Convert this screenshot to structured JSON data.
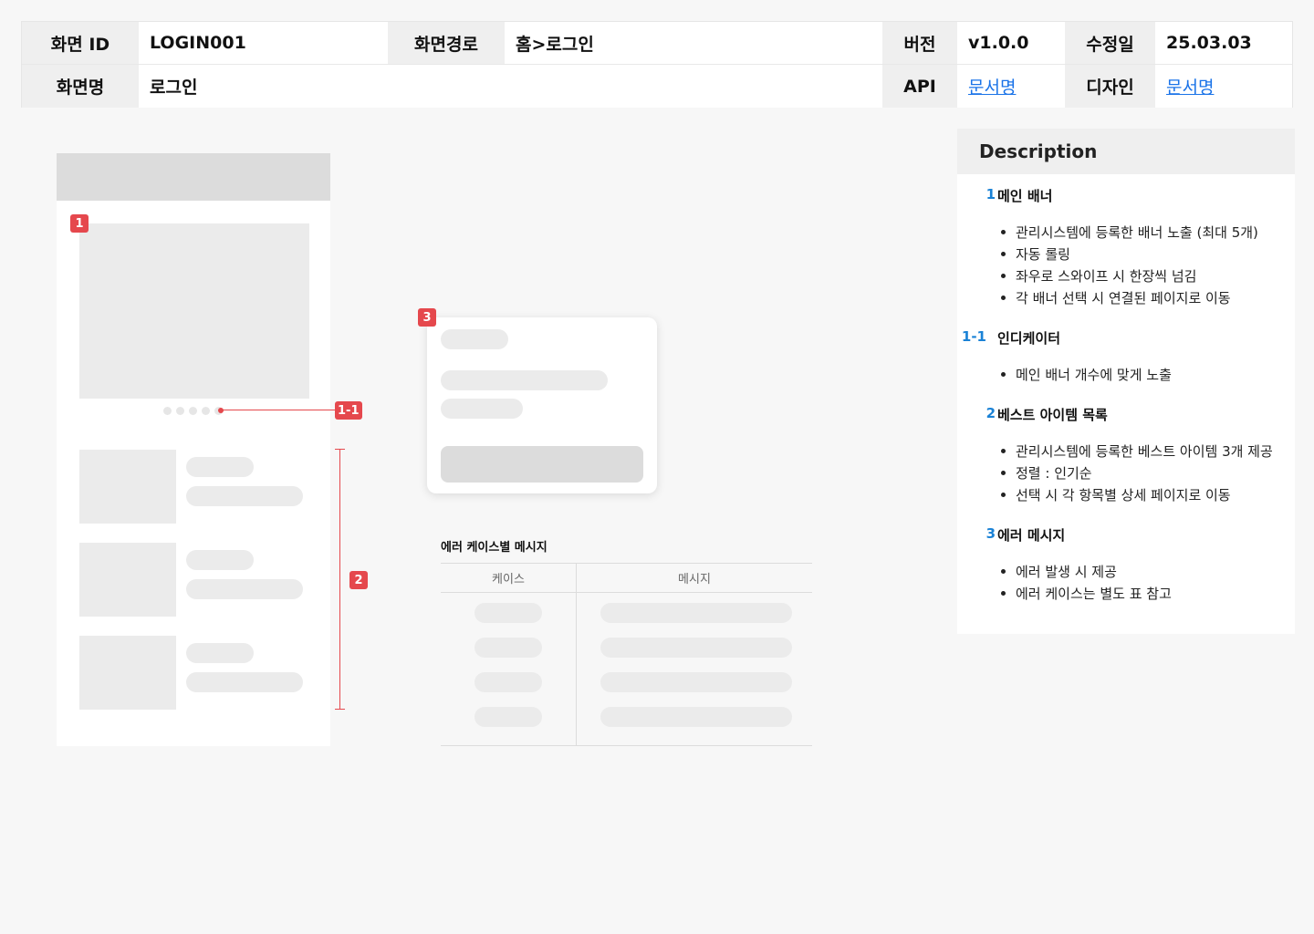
{
  "header": {
    "row1": [
      {
        "label": "화면 ID",
        "value": "LOGIN001"
      },
      {
        "label": "화면경로",
        "value": "홈>로그인"
      },
      {
        "label": "버전",
        "value": "v1.0.0"
      },
      {
        "label": "수정일",
        "value": "25.03.03"
      }
    ],
    "row2": [
      {
        "label": "화면명",
        "value": "로그인"
      },
      {
        "label": "API",
        "value": "문서명"
      },
      {
        "label": "디자인",
        "value": "문서명"
      }
    ]
  },
  "badges": {
    "b1": "1",
    "b11": "1-1",
    "b2": "2",
    "b3": "3"
  },
  "error_table": {
    "title": "에러 케이스별 메시지",
    "col_case": "케이스",
    "col_message": "메시지"
  },
  "description": {
    "title": "Description",
    "sections": [
      {
        "num": "1",
        "title": "메인 배너",
        "items": [
          "관리시스템에 등록한 배너 노출 (최대 5개)",
          "자동 롤링",
          "좌우로 스와이프 시 한장씩 넘김",
          "각 배너 선택 시 연결된 페이지로 이동"
        ]
      },
      {
        "num": "1-1",
        "title": "인디케이터",
        "items": [
          "메인 배너 개수에 맞게 노출"
        ]
      },
      {
        "num": "2",
        "title": "베스트 아이템 목록",
        "items": [
          "관리시스템에 등록한 베스트 아이템 3개 제공",
          "정렬 : 인기순",
          "선택 시 각 항목별 상세 페이지로 이동"
        ]
      },
      {
        "num": "3",
        "title": "에러 메시지",
        "items": [
          "에러 발생 시 제공",
          "에러 케이스는 별도 표 참고"
        ]
      }
    ]
  },
  "colors": {
    "accent": "#1a82d6",
    "marker": "#e5484d",
    "link": "#1a73e8"
  }
}
